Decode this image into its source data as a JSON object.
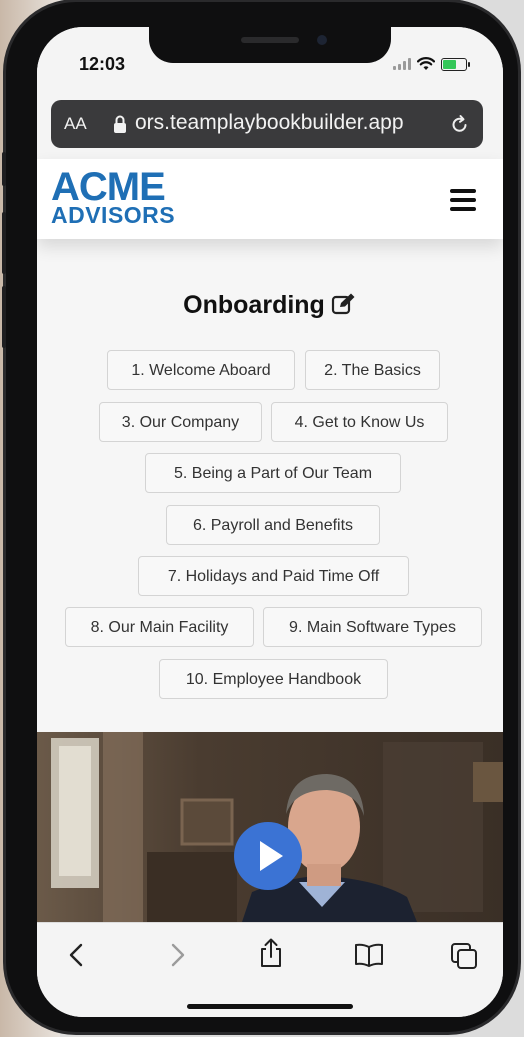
{
  "status_bar": {
    "time": "12:03"
  },
  "browser": {
    "text_size_label": "AA",
    "url": "ors.teamplaybookbuilder.app"
  },
  "app_header": {
    "logo_line1": "ACME",
    "logo_line2": "ADVISORS",
    "brand_color": "#1f6fb5"
  },
  "page": {
    "title": "Onboarding",
    "sections": [
      "1. Welcome Aboard",
      "2. The Basics",
      "3. Our Company",
      "4. Get to Know Us",
      "5. Being a Part of Our Team",
      "6. Payroll and Benefits",
      "7. Holidays and Paid Time Off",
      "8. Our Main Facility",
      "9. Main Software Types",
      "10. Employee Handbook"
    ]
  },
  "video": {
    "play_button_color": "#3b73d4"
  },
  "toolbar": {
    "icons": [
      "back-icon",
      "forward-icon",
      "share-icon",
      "bookmarks-icon",
      "tabs-icon"
    ]
  },
  "colors": {
    "battery": "#34c759",
    "url_bar": "#3a3a3c"
  }
}
